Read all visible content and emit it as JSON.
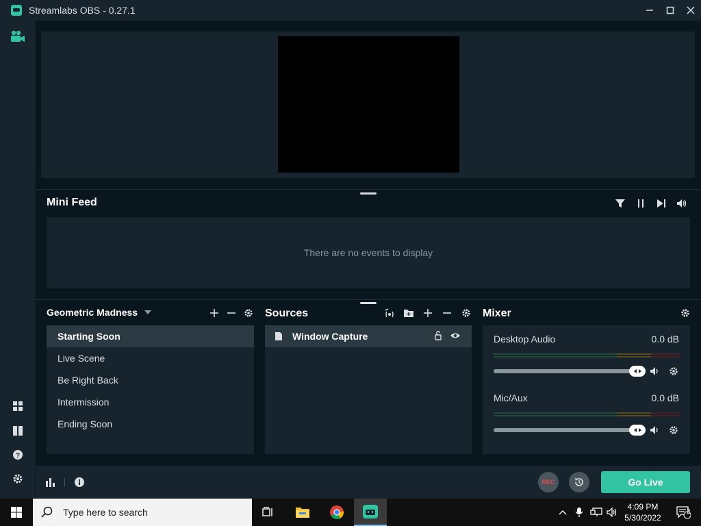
{
  "window": {
    "title": "Streamlabs OBS - 0.27.1",
    "minimize_glyph": "—",
    "maximize_glyph": "☐",
    "close_glyph": "✕"
  },
  "mini_feed": {
    "title": "Mini Feed",
    "empty_text": "There are no events to display"
  },
  "scenes": {
    "collection_name": "Geometric Madness",
    "items": [
      {
        "label": "Starting Soon"
      },
      {
        "label": "Live Scene"
      },
      {
        "label": "Be Right Back"
      },
      {
        "label": "Intermission"
      },
      {
        "label": "Ending Soon"
      }
    ],
    "active_index": 0
  },
  "sources": {
    "title": "Sources",
    "items": [
      {
        "label": "Window Capture"
      }
    ]
  },
  "mixer": {
    "title": "Mixer",
    "channels": [
      {
        "name": "Desktop Audio",
        "level": "0.0 dB",
        "volume": 1.0
      },
      {
        "name": "Mic/Aux",
        "level": "0.0 dB",
        "volume": 1.0
      }
    ]
  },
  "footer": {
    "rec_label": "REC",
    "go_live_label": "Go Live"
  },
  "taskbar": {
    "search_placeholder": "Type here to search",
    "time": "4:09 PM",
    "date": "5/30/2022",
    "notification_count": "2"
  },
  "colors": {
    "accent": "#31c3a2",
    "panel": "#17242d",
    "background": "#09161d"
  }
}
